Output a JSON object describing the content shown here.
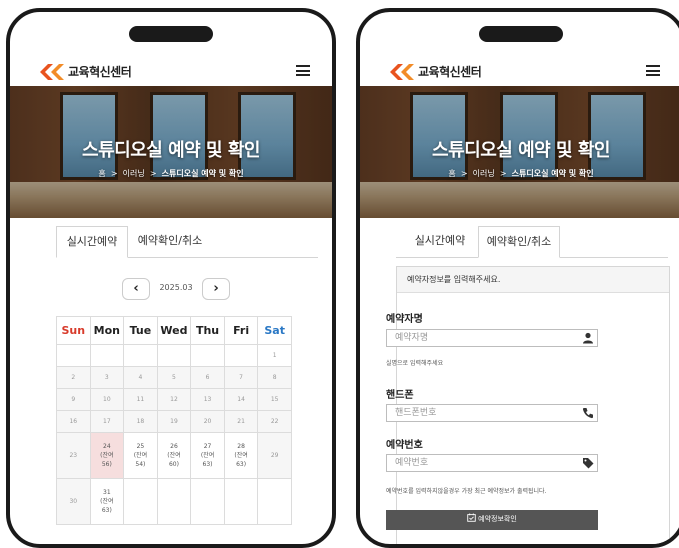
{
  "header": {
    "logo_text": "교육혁신센터",
    "logo_icon": "ck-logo-icon",
    "menu_icon": "hamburger-menu-icon"
  },
  "hero": {
    "title": "스튜디오실 예약 및 확인",
    "breadcrumb": [
      "홈",
      "이러닝",
      "스튜디오실 예약 및 확인"
    ]
  },
  "tabs": [
    {
      "label": "실시간예약"
    },
    {
      "label": "예약확인/취소"
    }
  ],
  "calendar": {
    "month": "2025.03",
    "prev_icon": "chevron-left-icon",
    "next_icon": "chevron-right-icon",
    "weekdays": [
      "Sun",
      "Mon",
      "Tue",
      "Wed",
      "Thu",
      "Fri",
      "Sat"
    ],
    "colors": {
      "sun": "#d83b2b",
      "sat": "#2a78c5",
      "selected": "#f6dede"
    },
    "weeks": [
      [
        "",
        "",
        "",
        "",
        "",
        "",
        "1"
      ],
      [
        "2",
        "3",
        "4",
        "5",
        "6",
        "7",
        "8"
      ],
      [
        "9",
        "10",
        "11",
        "12",
        "13",
        "14",
        "15"
      ],
      [
        "16",
        "17",
        "18",
        "19",
        "20",
        "21",
        "22"
      ],
      [
        {
          "day": "23"
        },
        {
          "day": "24",
          "remain": "(잔여",
          "count": "56)"
        },
        {
          "day": "25",
          "remain": "(잔여",
          "count": "54)"
        },
        {
          "day": "26",
          "remain": "(잔여",
          "count": "60)"
        },
        {
          "day": "27",
          "remain": "(잔여",
          "count": "63)"
        },
        {
          "day": "28",
          "remain": "(잔여",
          "count": "63)"
        },
        {
          "day": "29"
        }
      ],
      [
        {
          "day": "30"
        },
        {
          "day": "31",
          "remain": "(잔여",
          "count": "63)"
        }
      ]
    ]
  },
  "lookup": {
    "intro": "예약자정보를 입력해주세요.",
    "name_label": "예약자명",
    "name_placeholder": "예약자명",
    "name_icon": "user-icon",
    "name_help": "실명으로 입력해주세요",
    "phone_label": "핸드폰",
    "phone_placeholder": "핸드폰번호",
    "phone_icon": "phone-icon",
    "number_label": "예약번호",
    "number_placeholder": "예약번호",
    "number_icon": "tag-icon",
    "number_help": "예약번호를 입력하지않을경우 가장 최근 예약정보가 출력됩니다.",
    "confirm_button": "예약정보확인",
    "confirm_icon": "calendar-check-icon",
    "accent_color": "#555555"
  }
}
